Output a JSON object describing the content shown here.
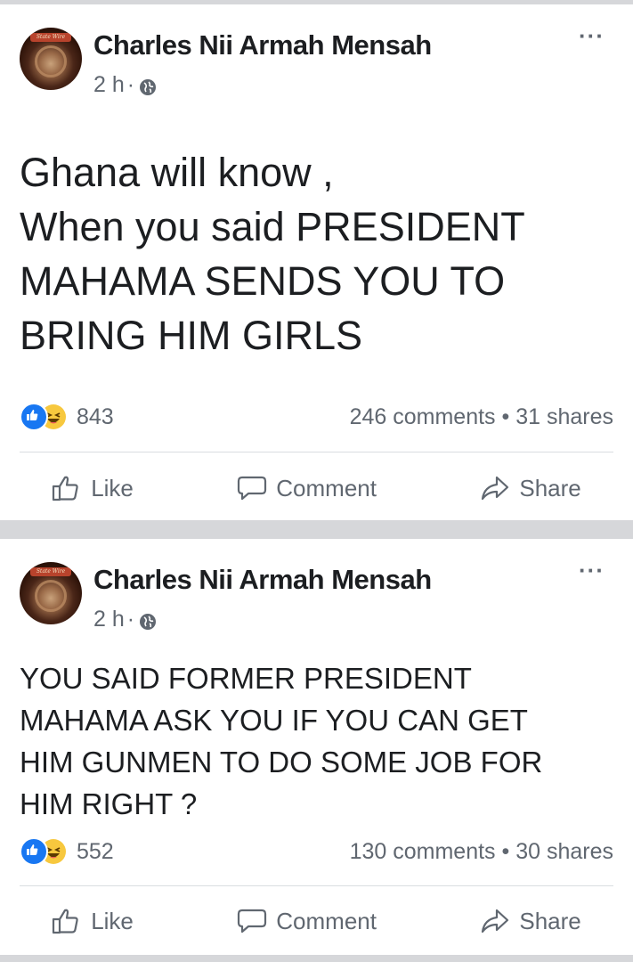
{
  "posts": [
    {
      "author": "Charles Nii Armah Mensah",
      "time": "2 h",
      "separator": "·",
      "more": "···",
      "avatar_text": "State Wire",
      "text_lines": [
        "Ghana will know ,",
        "When you said PRESIDENT",
        "MAHAMA SENDS YOU TO",
        "BRING HIM GIRLS"
      ],
      "reactions_count": "843",
      "comments": "246 comments",
      "shares": "31 shares",
      "stats_separator": " • ",
      "actions": {
        "like": "Like",
        "comment": "Comment",
        "share": "Share"
      }
    },
    {
      "author": "Charles Nii Armah Mensah",
      "time": "2 h",
      "separator": "·",
      "more": "···",
      "avatar_text": "State Wire",
      "text_lines": [
        "YOU SAID FORMER PRESIDENT",
        "MAHAMA ASK YOU IF YOU CAN GET",
        "HIM GUNMEN TO DO SOME JOB FOR",
        "HIM RIGHT ?"
      ],
      "reactions_count": "552",
      "comments": "130 comments",
      "shares": "30 shares",
      "stats_separator": " • ",
      "actions": {
        "like": "Like",
        "comment": "Comment",
        "share": "Share"
      }
    }
  ],
  "icons": {
    "visibility": "globe-icon",
    "reaction_1": "like-reaction-icon",
    "reaction_2": "haha-reaction-icon",
    "like": "thumbs-up-icon",
    "comment": "speech-bubble-icon",
    "share": "share-arrow-icon"
  },
  "colors": {
    "like_blue": "#1877f2",
    "haha_yellow": "#f7c83e",
    "secondary_text": "#606770",
    "separator_bg": "#d6d7da"
  }
}
